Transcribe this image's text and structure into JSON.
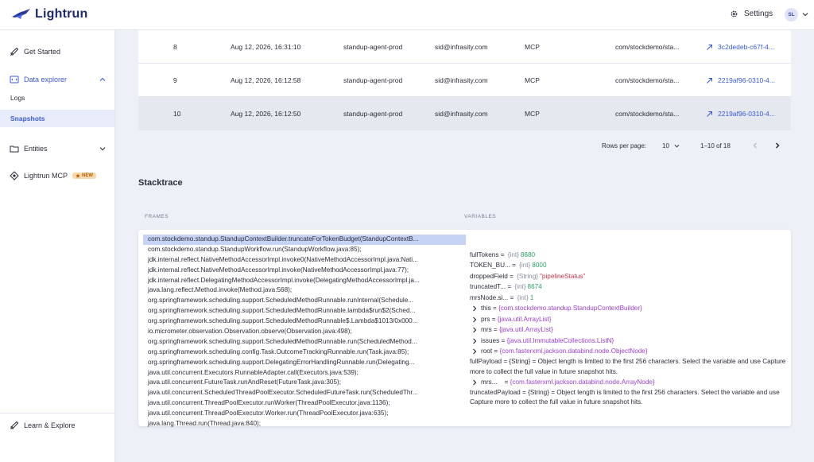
{
  "app": {
    "name": "Lightrun"
  },
  "header": {
    "settings_label": "Settings",
    "avatar_initials": "SL"
  },
  "sidebar": {
    "items": [
      {
        "label": "Get Started"
      },
      {
        "label": "Data explorer"
      },
      {
        "label": "Logs"
      },
      {
        "label": "Snapshots"
      },
      {
        "label": "Entities"
      },
      {
        "label": "Lightrun MCP",
        "badge": "NEW"
      },
      {
        "label": "Learn & Explore"
      }
    ]
  },
  "table": {
    "rows": [
      {
        "num": "8",
        "date": "Aug 12, 2026, 16:31:10",
        "agent": "standup-agent-prod",
        "user": "sid@infrasity.com",
        "source": "MCP",
        "location": "com/stockdemo/sta...",
        "id": "3c2dedeb-c67f-4..."
      },
      {
        "num": "9",
        "date": "Aug 12, 2026, 16:12:58",
        "agent": "standup-agent-prod",
        "user": "sid@infrasity.com",
        "source": "MCP",
        "location": "com/stockdemo/sta...",
        "id": "2219af96-0310-4..."
      },
      {
        "num": "10",
        "date": "Aug 12, 2026, 16:12:50",
        "agent": "standup-agent-prod",
        "user": "sid@infrasity.com",
        "source": "MCP",
        "location": "com/stockdemo/sta...",
        "id": "2219af96-0310-4..."
      }
    ],
    "pagination": {
      "rows_per_page_label": "Rows per page:",
      "rows_per_page_value": "10",
      "range": "1–10 of 18"
    }
  },
  "stacktrace": {
    "title": "Stacktrace",
    "frames_header": "FRAMES",
    "variables_header": "VARIABLES",
    "frames": [
      "com.stockdemo.standup.StandupContextBuilder.truncateForTokenBudget(StandupContextB...",
      "com.stockdemo.standup.StandupWorkflow.run(StandupWorkflow.java:85);",
      "jdk.internal.reflect.NativeMethodAccessorImpl.invoke0(NativeMethodAccessorImpl.java:Nati...",
      "jdk.internal.reflect.NativeMethodAccessorImpl.invoke(NativeMethodAccessorImpl.java:77);",
      "jdk.internal.reflect.DelegatingMethodAccessorImpl.invoke(DelegatingMethodAccessorImpl.ja...",
      "java.lang.reflect.Method.invoke(Method.java:568);",
      "org.springframework.scheduling.support.ScheduledMethodRunnable.runInternal(Schedule...",
      "org.springframework.scheduling.support.ScheduledMethodRunnable.lambda$run$2(Sched...",
      "org.springframework.scheduling.support.ScheduledMethodRunnable$.Lambda$1013/0x000...",
      "io.micrometer.observation.Observation.observe(Observation.java:498);",
      "org.springframework.scheduling.support.ScheduledMethodRunnable.run(ScheduledMethod...",
      "org.springframework.scheduling.config.Task.OutcomeTrackingRunnable.run(Task.java:85);",
      "org.springframework.scheduling.support.DelegatingErrorHandlingRunnable.run(Delegating...",
      "java.util.concurrent.Executors.RunnableAdapter.call(Executors.java:539);",
      "java.util.concurrent.FutureTask.runAndReset(FutureTask.java:305);",
      "java.util.concurrent.ScheduledThreadPoolExecutor.ScheduledFutureTask.run(ScheduledThr...",
      "java.util.concurrent.ThreadPoolExecutor.runWorker(ThreadPoolExecutor.java:1136);",
      "java.util.concurrent.ThreadPoolExecutor.Worker.run(ThreadPoolExecutor.java:635);",
      "java.lang.Thread.run(Thread.java:840);"
    ],
    "variables": [
      {
        "name": "fullTokens",
        "type": "{int}",
        "value": "8680",
        "kind": "num"
      },
      {
        "name": "TOKEN_BU...",
        "type": "{int}",
        "value": "8000",
        "kind": "num"
      },
      {
        "name": "droppedField",
        "type": "{String}",
        "value": "\"pipelineStatus\"",
        "kind": "str"
      },
      {
        "name": "truncatedT...",
        "type": "{int}",
        "value": "8674",
        "kind": "num"
      },
      {
        "name": "mrsNode.si...",
        "type": "{int}",
        "value": "1",
        "kind": "num"
      },
      {
        "name": "this",
        "value": "{com.stockdemo.standup.StandupContextBuilder}",
        "kind": "obj",
        "expandable": true
      },
      {
        "name": "prs",
        "value": "{java.util.ArrayList}",
        "kind": "obj",
        "expandable": true
      },
      {
        "name": "mrs",
        "value": "{java.util.ArrayList}",
        "kind": "obj",
        "expandable": true
      },
      {
        "name": "issues",
        "value": "{java.util.ImmutableCollections.ListN}",
        "kind": "obj",
        "expandable": true
      },
      {
        "name": "root",
        "value": "{com.fasterxml.jackson.databind.node.ObjectNode}",
        "kind": "obj",
        "expandable": true
      },
      {
        "name": "fullPayload",
        "type": "{String}",
        "value": "Object length is limited to the first 256 characters. Select the variable and use Capture more to collect the full value in future snapshot hits.",
        "kind": "text"
      },
      {
        "name": "mrs...",
        "value": "{com.fasterxml.jackson.databind.node.ArrayNode}",
        "kind": "obj",
        "expandable": true
      },
      {
        "name": "truncatedPayload",
        "type": "{String}",
        "value": "Object length is limited to the first 256 characters. Select the variable and use Capture more to collect the full value in future snapshot hits.",
        "kind": "text"
      }
    ]
  },
  "colors": {
    "accent": "#3a5bd9",
    "number": "#2aa36b",
    "string": "#d0344d",
    "object": "#9b3fd6"
  }
}
